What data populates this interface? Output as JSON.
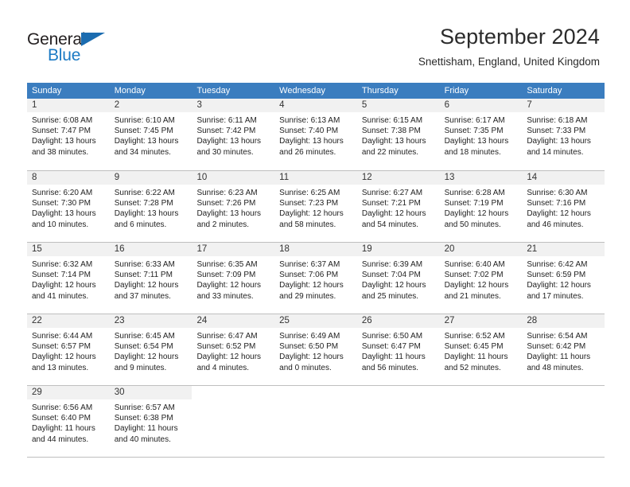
{
  "brand": {
    "name_top": "General",
    "name_bottom": "Blue",
    "color_dark": "#231f20",
    "color_blue": "#1b7ac4",
    "triangle_color": "#1b6cb0"
  },
  "header": {
    "title": "September 2024",
    "subtitle": "Snettisham, England, United Kingdom"
  },
  "calendar": {
    "header_bg": "#3b7dbf",
    "daynum_bg": "#f1f1f1",
    "grid_line": "#bfbfbf",
    "weekdays": [
      "Sunday",
      "Monday",
      "Tuesday",
      "Wednesday",
      "Thursday",
      "Friday",
      "Saturday"
    ],
    "weeks": [
      [
        {
          "day": "1",
          "sunrise": "Sunrise: 6:08 AM",
          "sunset": "Sunset: 7:47 PM",
          "daylight_line1": "Daylight: 13 hours",
          "daylight_line2": "and 38 minutes."
        },
        {
          "day": "2",
          "sunrise": "Sunrise: 6:10 AM",
          "sunset": "Sunset: 7:45 PM",
          "daylight_line1": "Daylight: 13 hours",
          "daylight_line2": "and 34 minutes."
        },
        {
          "day": "3",
          "sunrise": "Sunrise: 6:11 AM",
          "sunset": "Sunset: 7:42 PM",
          "daylight_line1": "Daylight: 13 hours",
          "daylight_line2": "and 30 minutes."
        },
        {
          "day": "4",
          "sunrise": "Sunrise: 6:13 AM",
          "sunset": "Sunset: 7:40 PM",
          "daylight_line1": "Daylight: 13 hours",
          "daylight_line2": "and 26 minutes."
        },
        {
          "day": "5",
          "sunrise": "Sunrise: 6:15 AM",
          "sunset": "Sunset: 7:38 PM",
          "daylight_line1": "Daylight: 13 hours",
          "daylight_line2": "and 22 minutes."
        },
        {
          "day": "6",
          "sunrise": "Sunrise: 6:17 AM",
          "sunset": "Sunset: 7:35 PM",
          "daylight_line1": "Daylight: 13 hours",
          "daylight_line2": "and 18 minutes."
        },
        {
          "day": "7",
          "sunrise": "Sunrise: 6:18 AM",
          "sunset": "Sunset: 7:33 PM",
          "daylight_line1": "Daylight: 13 hours",
          "daylight_line2": "and 14 minutes."
        }
      ],
      [
        {
          "day": "8",
          "sunrise": "Sunrise: 6:20 AM",
          "sunset": "Sunset: 7:30 PM",
          "daylight_line1": "Daylight: 13 hours",
          "daylight_line2": "and 10 minutes."
        },
        {
          "day": "9",
          "sunrise": "Sunrise: 6:22 AM",
          "sunset": "Sunset: 7:28 PM",
          "daylight_line1": "Daylight: 13 hours",
          "daylight_line2": "and 6 minutes."
        },
        {
          "day": "10",
          "sunrise": "Sunrise: 6:23 AM",
          "sunset": "Sunset: 7:26 PM",
          "daylight_line1": "Daylight: 13 hours",
          "daylight_line2": "and 2 minutes."
        },
        {
          "day": "11",
          "sunrise": "Sunrise: 6:25 AM",
          "sunset": "Sunset: 7:23 PM",
          "daylight_line1": "Daylight: 12 hours",
          "daylight_line2": "and 58 minutes."
        },
        {
          "day": "12",
          "sunrise": "Sunrise: 6:27 AM",
          "sunset": "Sunset: 7:21 PM",
          "daylight_line1": "Daylight: 12 hours",
          "daylight_line2": "and 54 minutes."
        },
        {
          "day": "13",
          "sunrise": "Sunrise: 6:28 AM",
          "sunset": "Sunset: 7:19 PM",
          "daylight_line1": "Daylight: 12 hours",
          "daylight_line2": "and 50 minutes."
        },
        {
          "day": "14",
          "sunrise": "Sunrise: 6:30 AM",
          "sunset": "Sunset: 7:16 PM",
          "daylight_line1": "Daylight: 12 hours",
          "daylight_line2": "and 46 minutes."
        }
      ],
      [
        {
          "day": "15",
          "sunrise": "Sunrise: 6:32 AM",
          "sunset": "Sunset: 7:14 PM",
          "daylight_line1": "Daylight: 12 hours",
          "daylight_line2": "and 41 minutes."
        },
        {
          "day": "16",
          "sunrise": "Sunrise: 6:33 AM",
          "sunset": "Sunset: 7:11 PM",
          "daylight_line1": "Daylight: 12 hours",
          "daylight_line2": "and 37 minutes."
        },
        {
          "day": "17",
          "sunrise": "Sunrise: 6:35 AM",
          "sunset": "Sunset: 7:09 PM",
          "daylight_line1": "Daylight: 12 hours",
          "daylight_line2": "and 33 minutes."
        },
        {
          "day": "18",
          "sunrise": "Sunrise: 6:37 AM",
          "sunset": "Sunset: 7:06 PM",
          "daylight_line1": "Daylight: 12 hours",
          "daylight_line2": "and 29 minutes."
        },
        {
          "day": "19",
          "sunrise": "Sunrise: 6:39 AM",
          "sunset": "Sunset: 7:04 PM",
          "daylight_line1": "Daylight: 12 hours",
          "daylight_line2": "and 25 minutes."
        },
        {
          "day": "20",
          "sunrise": "Sunrise: 6:40 AM",
          "sunset": "Sunset: 7:02 PM",
          "daylight_line1": "Daylight: 12 hours",
          "daylight_line2": "and 21 minutes."
        },
        {
          "day": "21",
          "sunrise": "Sunrise: 6:42 AM",
          "sunset": "Sunset: 6:59 PM",
          "daylight_line1": "Daylight: 12 hours",
          "daylight_line2": "and 17 minutes."
        }
      ],
      [
        {
          "day": "22",
          "sunrise": "Sunrise: 6:44 AM",
          "sunset": "Sunset: 6:57 PM",
          "daylight_line1": "Daylight: 12 hours",
          "daylight_line2": "and 13 minutes."
        },
        {
          "day": "23",
          "sunrise": "Sunrise: 6:45 AM",
          "sunset": "Sunset: 6:54 PM",
          "daylight_line1": "Daylight: 12 hours",
          "daylight_line2": "and 9 minutes."
        },
        {
          "day": "24",
          "sunrise": "Sunrise: 6:47 AM",
          "sunset": "Sunset: 6:52 PM",
          "daylight_line1": "Daylight: 12 hours",
          "daylight_line2": "and 4 minutes."
        },
        {
          "day": "25",
          "sunrise": "Sunrise: 6:49 AM",
          "sunset": "Sunset: 6:50 PM",
          "daylight_line1": "Daylight: 12 hours",
          "daylight_line2": "and 0 minutes."
        },
        {
          "day": "26",
          "sunrise": "Sunrise: 6:50 AM",
          "sunset": "Sunset: 6:47 PM",
          "daylight_line1": "Daylight: 11 hours",
          "daylight_line2": "and 56 minutes."
        },
        {
          "day": "27",
          "sunrise": "Sunrise: 6:52 AM",
          "sunset": "Sunset: 6:45 PM",
          "daylight_line1": "Daylight: 11 hours",
          "daylight_line2": "and 52 minutes."
        },
        {
          "day": "28",
          "sunrise": "Sunrise: 6:54 AM",
          "sunset": "Sunset: 6:42 PM",
          "daylight_line1": "Daylight: 11 hours",
          "daylight_line2": "and 48 minutes."
        }
      ],
      [
        {
          "day": "29",
          "sunrise": "Sunrise: 6:56 AM",
          "sunset": "Sunset: 6:40 PM",
          "daylight_line1": "Daylight: 11 hours",
          "daylight_line2": "and 44 minutes."
        },
        {
          "day": "30",
          "sunrise": "Sunrise: 6:57 AM",
          "sunset": "Sunset: 6:38 PM",
          "daylight_line1": "Daylight: 11 hours",
          "daylight_line2": "and 40 minutes."
        },
        {
          "day": "",
          "sunrise": "",
          "sunset": "",
          "daylight_line1": "",
          "daylight_line2": ""
        },
        {
          "day": "",
          "sunrise": "",
          "sunset": "",
          "daylight_line1": "",
          "daylight_line2": ""
        },
        {
          "day": "",
          "sunrise": "",
          "sunset": "",
          "daylight_line1": "",
          "daylight_line2": ""
        },
        {
          "day": "",
          "sunrise": "",
          "sunset": "",
          "daylight_line1": "",
          "daylight_line2": ""
        },
        {
          "day": "",
          "sunrise": "",
          "sunset": "",
          "daylight_line1": "",
          "daylight_line2": ""
        }
      ]
    ]
  }
}
